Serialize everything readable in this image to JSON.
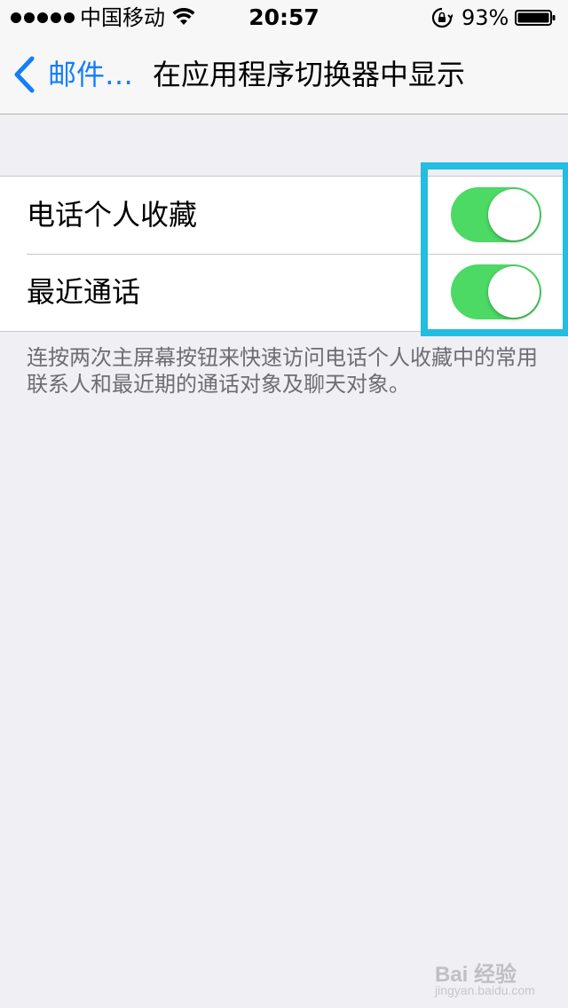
{
  "status_bar": {
    "carrier": "中国移动",
    "time": "20:57",
    "battery_percent": "93%"
  },
  "nav": {
    "back_label": "邮件…",
    "title": "在应用程序切换器中显示"
  },
  "settings": {
    "rows": [
      {
        "label": "电话个人收藏",
        "toggle_on": true
      },
      {
        "label": "最近通话",
        "toggle_on": true
      }
    ],
    "footer": "连按两次主屏幕按钮来快速访问电话个人收藏中的常用联系人和最近期的通话对象及聊天对象。"
  },
  "watermark": {
    "text": "Bai 经验",
    "url": "jingyan.baidu.com"
  },
  "colors": {
    "accent_blue": "#147efb",
    "switch_green": "#4cd964",
    "highlight": "#22bde0",
    "background": "#efeff4"
  }
}
